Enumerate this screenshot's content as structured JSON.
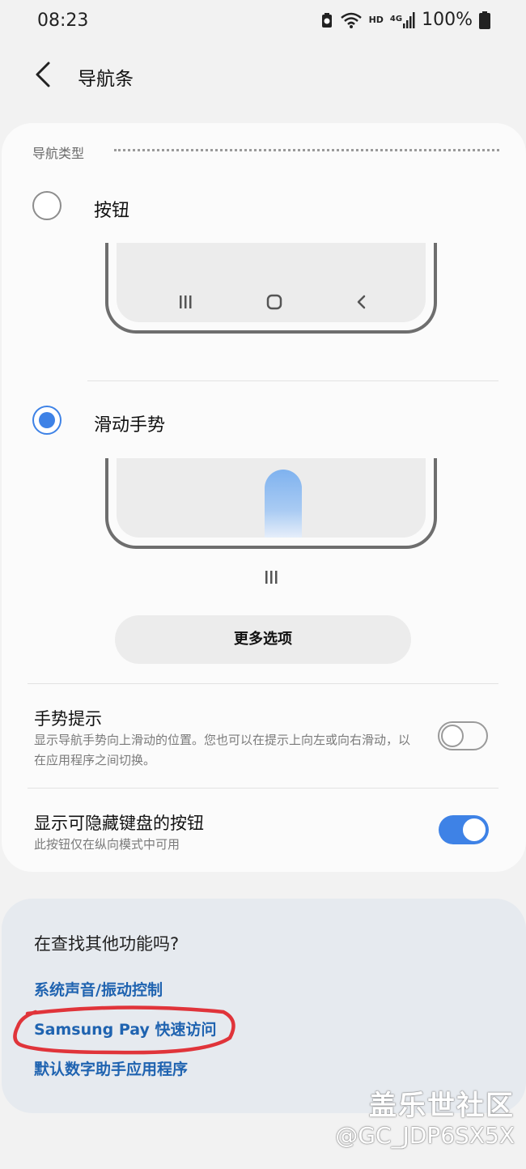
{
  "status_bar": {
    "time": "08:23",
    "network_hd": "HD",
    "network_gen": "4G",
    "battery_percent": "100%"
  },
  "header": {
    "title": "导航条"
  },
  "navigation_type": {
    "section_label": "导航类型",
    "options": [
      {
        "label": "按钮",
        "selected": false
      },
      {
        "label": "滑动手势",
        "selected": true
      }
    ],
    "more_options_label": "更多选项"
  },
  "settings": [
    {
      "title": "手势提示",
      "description": "显示导航手势向上滑动的位置。您也可以在提示上向左或向右滑动，以在应用程序之间切换。",
      "enabled": false
    },
    {
      "title": "显示可隐藏键盘的按钮",
      "description": "此按钮仅在纵向模式中可用",
      "enabled": true
    }
  ],
  "suggestions": {
    "title": "在查找其他功能吗?",
    "links": [
      "系统声音/振动控制",
      "Samsung Pay 快速访问",
      "默认数字助手应用程序"
    ]
  },
  "watermark": {
    "line1": "盖乐世社区",
    "line2": "@GC_JDP6SX5X"
  },
  "colors": {
    "accent": "#3e82e6",
    "link": "#1f63b0",
    "annotation": "#e0343a"
  }
}
